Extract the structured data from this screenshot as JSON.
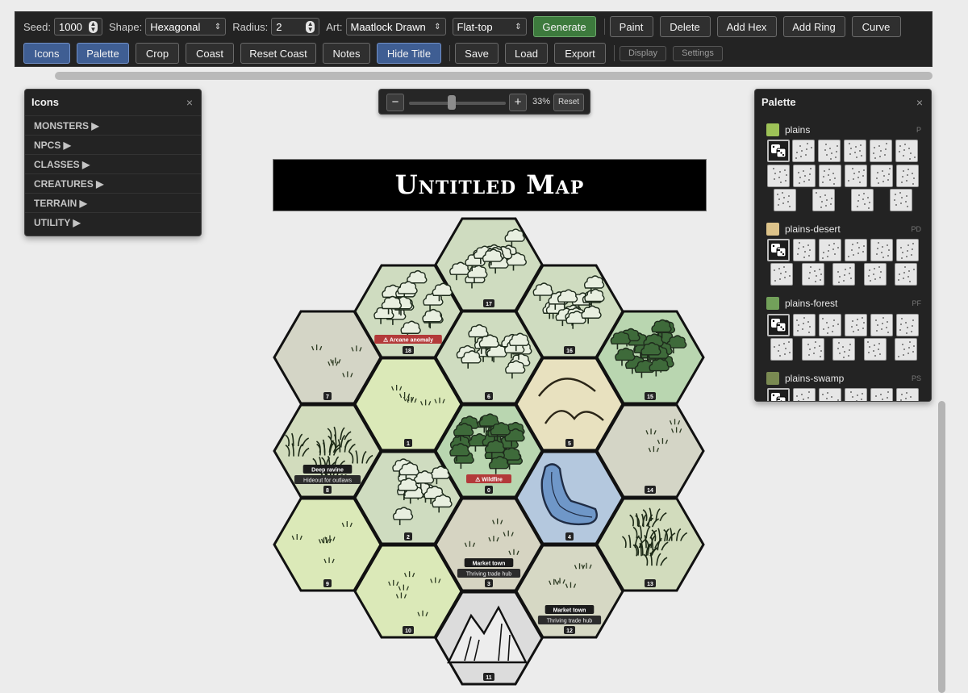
{
  "toolbar": {
    "seed_label": "Seed:",
    "seed_value": "1000",
    "shape_label": "Shape:",
    "shape_value": "Hexagonal",
    "radius_label": "Radius:",
    "radius_value": "2",
    "art_label": "Art:",
    "art_value": "Maatlock Drawn",
    "orientation_value": "Flat-top",
    "generate": "Generate",
    "paint": "Paint",
    "delete": "Delete",
    "add_hex": "Add Hex",
    "add_ring": "Add Ring",
    "curve": "Curve",
    "icons": "Icons",
    "palette": "Palette",
    "crop": "Crop",
    "coast": "Coast",
    "reset_coast": "Reset Coast",
    "notes": "Notes",
    "hide_title": "Hide Title",
    "save": "Save",
    "load": "Load",
    "export": "Export",
    "display": "Display",
    "settings": "Settings"
  },
  "zoom": {
    "minus": "−",
    "plus": "+",
    "percent": "33%",
    "reset": "Reset",
    "level": 0.33
  },
  "icons_panel": {
    "title": "Icons",
    "close": "×",
    "categories": [
      "MONSTERS ▶",
      "NPCS ▶",
      "CLASSES ▶",
      "CREATURES ▶",
      "TERRAIN ▶",
      "UTILITY ▶"
    ]
  },
  "palette_panel": {
    "title": "Palette",
    "close": "×",
    "groups": [
      {
        "name": "plains",
        "key": "P",
        "color": "#9dc257"
      },
      {
        "name": "plains-desert",
        "key": "PD",
        "color": "#ddc38a"
      },
      {
        "name": "plains-forest",
        "key": "PF",
        "color": "#72a05a"
      },
      {
        "name": "plains-swamp",
        "key": "PS",
        "color": "#7a8a52"
      }
    ]
  },
  "map": {
    "title": "Untitled Map",
    "hexes": [
      {
        "num": "0",
        "terrain": "dense-forest",
        "color": "#b9d6b0"
      },
      {
        "num": "1",
        "terrain": "grass",
        "color": "#dbe9b8"
      },
      {
        "num": "2",
        "terrain": "forest",
        "color": "#cfdcc0"
      },
      {
        "num": "3",
        "terrain": "grass-sparse",
        "color": "#d6d4c2"
      },
      {
        "num": "4",
        "terrain": "lake",
        "color": "#b4c8de"
      },
      {
        "num": "5",
        "terrain": "hills",
        "color": "#e8e1bf"
      },
      {
        "num": "6",
        "terrain": "forest",
        "color": "#cfdcc0"
      },
      {
        "num": "7",
        "terrain": "grass-sparse",
        "color": "#d4d5c6"
      },
      {
        "num": "8",
        "terrain": "brush",
        "color": "#d2dcbd"
      },
      {
        "num": "9",
        "terrain": "grass",
        "color": "#dbe9b8"
      },
      {
        "num": "10",
        "terrain": "grass",
        "color": "#dbe9b8"
      },
      {
        "num": "11",
        "terrain": "mountains",
        "color": "#dcdcdc"
      },
      {
        "num": "12",
        "terrain": "grass-sparse",
        "color": "#d6d8c4"
      },
      {
        "num": "13",
        "terrain": "brush",
        "color": "#d2dcbd"
      },
      {
        "num": "14",
        "terrain": "grass-sparse",
        "color": "#d4d5c6"
      },
      {
        "num": "15",
        "terrain": "dense-forest",
        "color": "#b9d6b0"
      },
      {
        "num": "16",
        "terrain": "forest",
        "color": "#cfdcc0"
      },
      {
        "num": "17",
        "terrain": "forest",
        "color": "#cfdcc0"
      },
      {
        "num": "18",
        "terrain": "forest",
        "color": "#cfdcc0"
      }
    ],
    "labels": [
      {
        "hex": "18",
        "title": "⚠ Arcane anomaly",
        "kind": "warning"
      },
      {
        "hex": "0",
        "title": "⚠ Wildfire",
        "kind": "warning"
      },
      {
        "hex": "8",
        "title": "Deep ravine",
        "note": "Hideout for outlaws",
        "kind": "note"
      },
      {
        "hex": "3",
        "title": "Market town",
        "note": "Thriving trade hub",
        "kind": "note"
      },
      {
        "hex": "12",
        "title": "Market town",
        "note": "Thriving trade hub",
        "kind": "note"
      }
    ]
  }
}
